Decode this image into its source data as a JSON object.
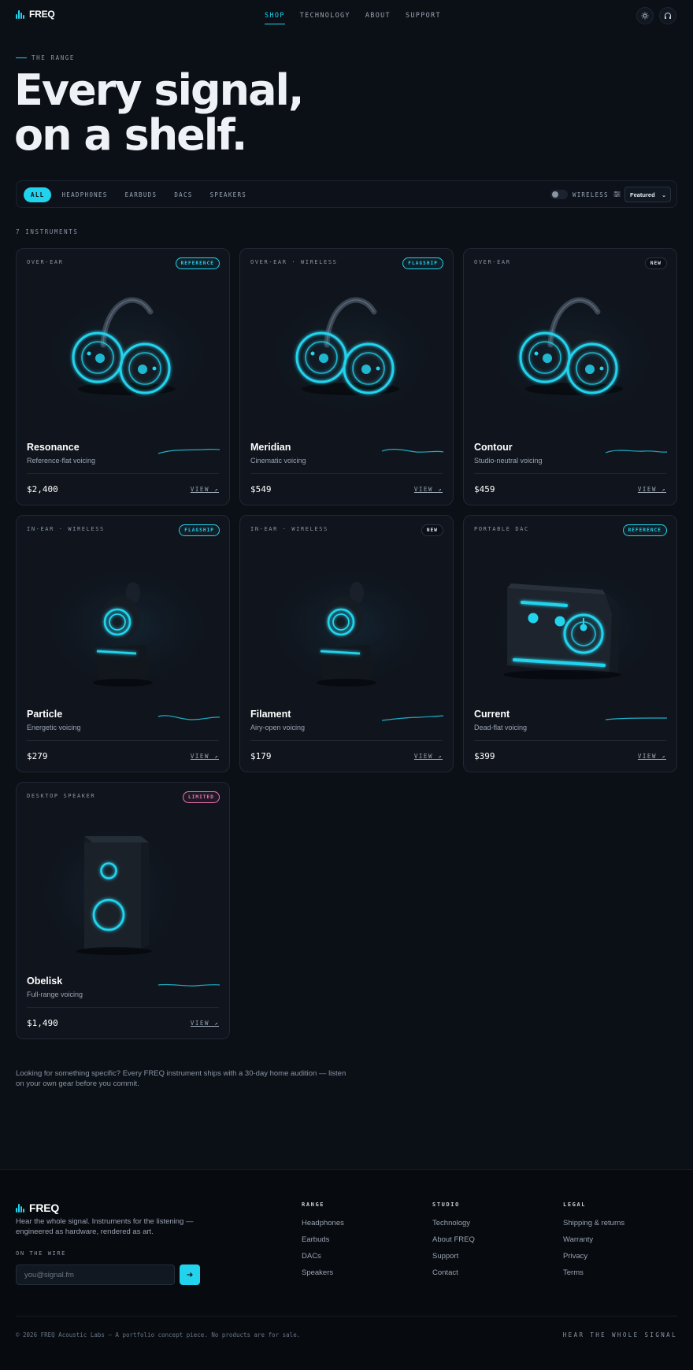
{
  "brand": {
    "name": "FREQ"
  },
  "nav": {
    "items": [
      {
        "label": "SHOP",
        "active": true
      },
      {
        "label": "TECHNOLOGY",
        "active": false
      },
      {
        "label": "ABOUT",
        "active": false
      },
      {
        "label": "SUPPORT",
        "active": false
      }
    ],
    "theme_icon": "sun-icon",
    "listen_icon": "headphones-icon"
  },
  "hero": {
    "eyebrow": "THE RANGE",
    "title_line1": "Every signal,",
    "title_line2": "on a shelf."
  },
  "filters": {
    "chips": [
      {
        "label": "ALL",
        "active": true
      },
      {
        "label": "HEADPHONES",
        "active": false
      },
      {
        "label": "EARBUDS",
        "active": false
      },
      {
        "label": "DACS",
        "active": false
      },
      {
        "label": "SPEAKERS",
        "active": false
      }
    ],
    "wireless_label": "WIRELESS",
    "wireless_on": false,
    "sort_selected": "Featured",
    "sort_caret": "⌄"
  },
  "results_count": "7 INSTRUMENTS",
  "products": [
    {
      "category": "OVER-EAR",
      "badge": "REFERENCE",
      "badge_type": "reference",
      "name": "Resonance",
      "voicing": "Reference-flat voicing",
      "price": "$2,400",
      "view": "VIEW ↗",
      "art": "headphones"
    },
    {
      "category": "OVER-EAR · WIRELESS",
      "badge": "FLAGSHIP",
      "badge_type": "flagship",
      "name": "Meridian",
      "voicing": "Cinematic voicing",
      "price": "$549",
      "view": "VIEW ↗",
      "art": "headphones"
    },
    {
      "category": "OVER-EAR",
      "badge": "NEW",
      "badge_type": "new",
      "name": "Contour",
      "voicing": "Studio-neutral voicing",
      "price": "$459",
      "view": "VIEW ↗",
      "art": "headphones"
    },
    {
      "category": "IN-EAR · WIRELESS",
      "badge": "FLAGSHIP",
      "badge_type": "flagship",
      "name": "Particle",
      "voicing": "Energetic voicing",
      "price": "$279",
      "view": "VIEW ↗",
      "art": "earbud"
    },
    {
      "category": "IN-EAR · WIRELESS",
      "badge": "NEW",
      "badge_type": "new",
      "name": "Filament",
      "voicing": "Airy-open voicing",
      "price": "$179",
      "view": "VIEW ↗",
      "art": "earbud"
    },
    {
      "category": "PORTABLE DAC",
      "badge": "REFERENCE",
      "badge_type": "reference",
      "name": "Current",
      "voicing": "Dead-flat voicing",
      "price": "$399",
      "view": "VIEW ↗",
      "art": "dac"
    },
    {
      "category": "DESKTOP SPEAKER",
      "badge": "LIMITED",
      "badge_type": "limited",
      "name": "Obelisk",
      "voicing": "Full-range voicing",
      "price": "$1,490",
      "view": "VIEW ↗",
      "art": "speaker"
    }
  ],
  "note": "Looking for something specific? Every FREQ instrument ships with a 30-day home audition — listen on your own gear before you commit.",
  "footer": {
    "tagline": "Hear the whole signal. Instruments for the listening — engineered as hardware, rendered as art.",
    "newsletter_label": "ON THE WIRE",
    "email_placeholder": "you@signal.fm",
    "submit_icon": "arrow-right-icon",
    "columns": [
      {
        "title": "RANGE",
        "links": [
          "Headphones",
          "Earbuds",
          "DACs",
          "Speakers"
        ]
      },
      {
        "title": "STUDIO",
        "links": [
          "Technology",
          "About FREQ",
          "Support",
          "Contact"
        ]
      },
      {
        "title": "LEGAL",
        "links": [
          "Shipping & returns",
          "Warranty",
          "Privacy",
          "Terms"
        ]
      }
    ],
    "copyright": "© 2026 FREQ Acoustic Labs — A portfolio concept piece. No products are for sale.",
    "motto": "HEAR THE WHOLE SIGNAL"
  },
  "colors": {
    "accent": "#22d3ee",
    "limited": "#f472b6",
    "background": "#0b0f16",
    "card": "#10151d"
  }
}
